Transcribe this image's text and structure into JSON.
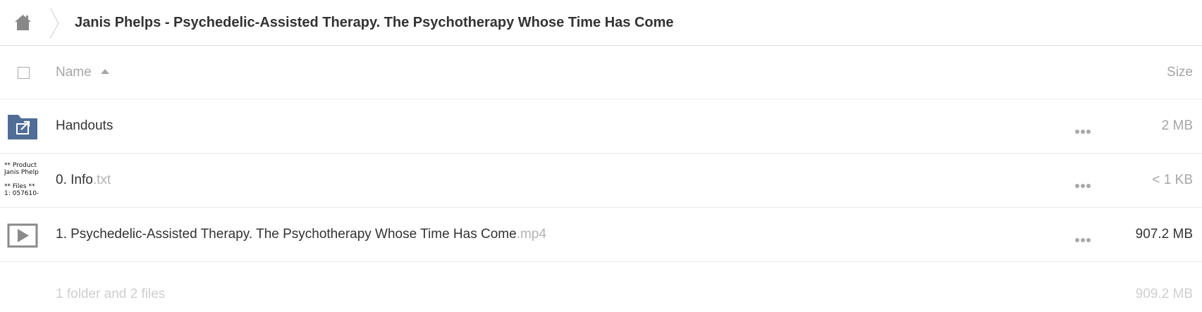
{
  "breadcrumb": {
    "home_icon": "home-icon",
    "current": "Janis Phelps - Psychedelic-Assisted Therapy. The Psychotherapy Whose Time Has Come"
  },
  "table": {
    "header": {
      "name_label": "Name",
      "sort": "ascending",
      "size_label": "Size"
    },
    "rows": [
      {
        "icon": "shared-folder-icon",
        "name": "Handouts",
        "ext": "",
        "size": "2 MB"
      },
      {
        "icon": "text-file-thumbnail",
        "thumbnail_text": "** Product\nJanis Phelp\n\n** Files **\n1: 057610-",
        "name": "0. Info",
        "ext": ".txt",
        "size": "< 1 KB"
      },
      {
        "icon": "video-play-icon",
        "name": "1. Psychedelic-Assisted Therapy. The Psychotherapy Whose Time Has Come",
        "ext": ".mp4",
        "size": "907.2 MB"
      }
    ],
    "summary": {
      "text": "1 folder and 2 files",
      "total_size": "909.2 MB"
    }
  },
  "colors": {
    "folder_blue": "#4f6d97",
    "muted_text": "#a6a6a6",
    "icon_grey": "#8a8a8a"
  }
}
